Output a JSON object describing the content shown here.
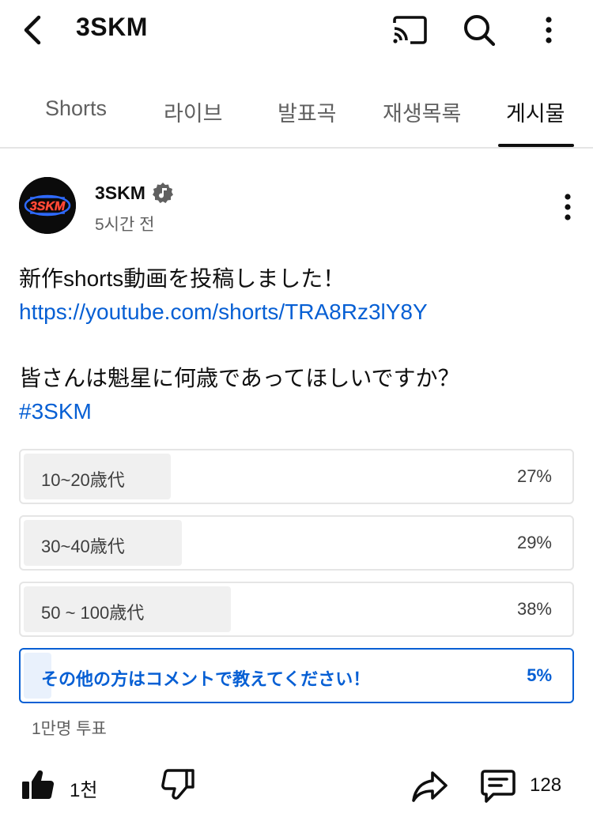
{
  "header": {
    "title": "3SKM",
    "icons": {
      "back": "back-arrow-icon",
      "cast": "cast-icon",
      "search": "search-icon",
      "more": "more-vert-icon"
    }
  },
  "tabs": [
    {
      "label": "Shorts",
      "active": false
    },
    {
      "label": "라이브",
      "active": false
    },
    {
      "label": "발표곡",
      "active": false
    },
    {
      "label": "재생목록",
      "active": false
    },
    {
      "label": "게시물",
      "active": true
    }
  ],
  "post": {
    "author": "3SKM",
    "avatar_text": "3SKM",
    "time": "5시간 전",
    "text_line1": "新作shorts動画を投稿しました！",
    "link": "https://youtube.com/shorts/TRA8Rz3lY8Y",
    "text_line2": "皆さんは魁星に何歳であってほしいですか？",
    "hashtag": "#3SKM"
  },
  "poll": {
    "options": [
      {
        "label": "10~20歳代",
        "percent_text": "27%",
        "percent": 27,
        "selected": false
      },
      {
        "label": "30~40歳代",
        "percent_text": "29%",
        "percent": 29,
        "selected": false
      },
      {
        "label": "50 ~ 100歳代",
        "percent_text": "38%",
        "percent": 38,
        "selected": false
      },
      {
        "label": "その他の方はコメントで教えてください！",
        "percent_text": "5%",
        "percent": 5,
        "selected": true
      }
    ],
    "votes": "1만명 투표"
  },
  "actions": {
    "like_count": "1천",
    "comment_count": "128"
  },
  "colors": {
    "link": "#065fd4",
    "text": "#0f0f0f",
    "secondary": "#606060",
    "poll_fill": "#f0f0f0",
    "poll_selected_fill": "#e9f1fc"
  }
}
